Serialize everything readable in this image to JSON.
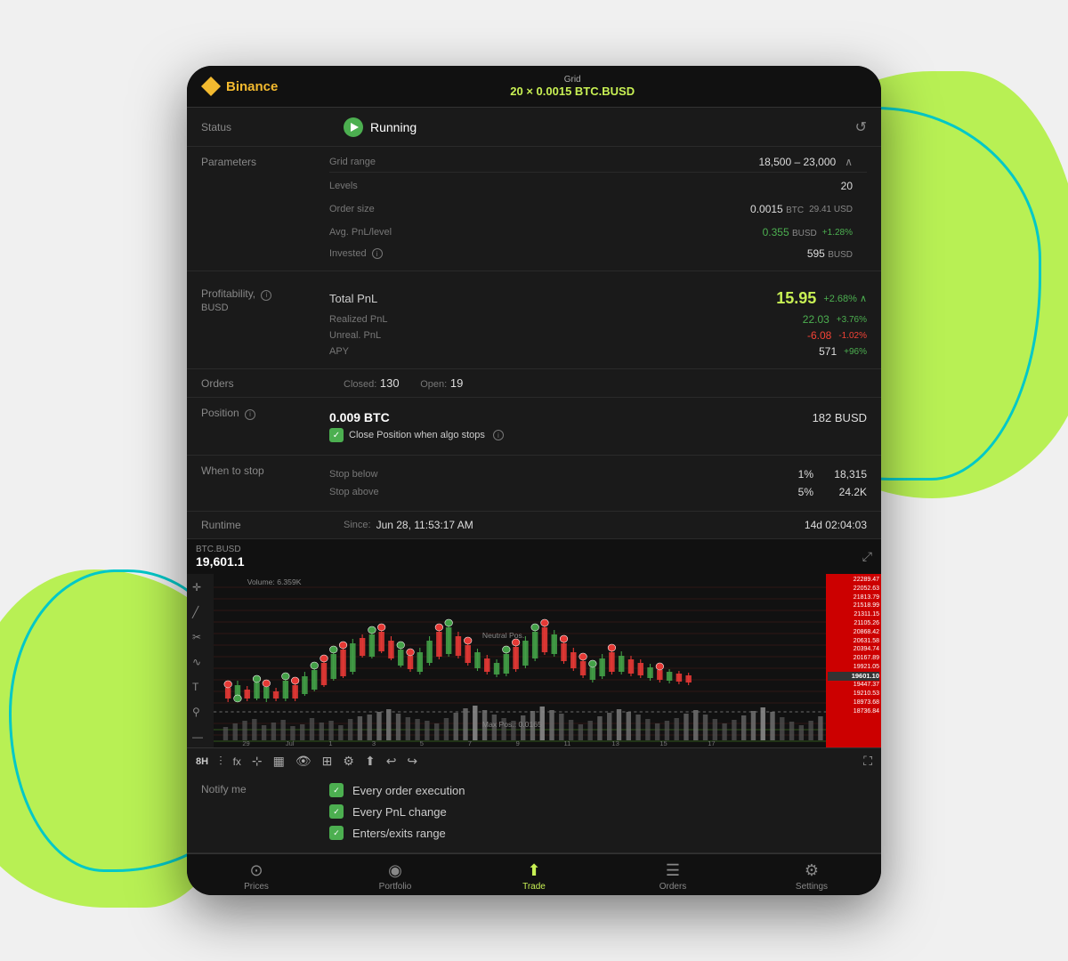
{
  "app": {
    "exchange": "Binance",
    "grid_label": "Grid",
    "grid_value": "20 × 0.0015 BTC.BUSD"
  },
  "status": {
    "label": "Status",
    "value": "Running",
    "refresh_icon": "↺"
  },
  "parameters": {
    "label": "Parameters",
    "grid_range_label": "Grid range",
    "grid_range_value": "18,500 – 23,000",
    "levels_label": "Levels",
    "levels_value": "20",
    "order_size_label": "Order size",
    "order_size_value": "0.0015",
    "order_size_unit": "BTC",
    "order_size_usd": "29.41 USD",
    "avg_pnl_label": "Avg. PnL/level",
    "avg_pnl_value": "0.355",
    "avg_pnl_unit": "BUSD",
    "avg_pnl_pct": "+1.28%",
    "invested_label": "Invested",
    "invested_value": "595",
    "invested_unit": "BUSD"
  },
  "profitability": {
    "label": "Profitability,",
    "unit": "BUSD",
    "total_pnl_label": "Total PnL",
    "total_pnl_value": "15.95",
    "total_pnl_pct": "+2.68%",
    "realized_label": "Realized PnL",
    "realized_value": "22.03",
    "realized_pct": "+3.76%",
    "unrealized_label": "Unreal. PnL",
    "unrealized_value": "-6.08",
    "unrealized_pct": "-1.02%",
    "apy_label": "APY",
    "apy_value": "571",
    "apy_pct": "+96%"
  },
  "orders": {
    "label": "Orders",
    "closed_label": "Closed:",
    "closed_value": "130",
    "open_label": "Open:",
    "open_value": "19"
  },
  "position": {
    "label": "Position",
    "btc_value": "0.009 BTC",
    "busd_value": "182 BUSD",
    "close_position_text": "Close Position when algo stops"
  },
  "when_to_stop": {
    "label": "When to stop",
    "stop_below_label": "Stop below",
    "stop_below_pct": "1%",
    "stop_below_value": "18,315",
    "stop_above_label": "Stop above",
    "stop_above_pct": "5%",
    "stop_above_value": "24.2K"
  },
  "runtime": {
    "label": "Runtime",
    "since_label": "Since:",
    "since_value": "Jun 28, 11:53:17 AM",
    "elapsed": "14d 02:04:03"
  },
  "chart": {
    "symbol": "BTC.BUSD",
    "price": "19,601.1",
    "time_frame": "8H",
    "price_levels": [
      "22289.47",
      "22052.63",
      "21813.79",
      "21518.99",
      "21311.15",
      "21105.26",
      "20868.42",
      "20631.58",
      "20394.74",
      "20167.89",
      "19921.05",
      "19601.10",
      "19447.37",
      "19210.53",
      "18973.68",
      "18736.84"
    ],
    "x_labels": [
      "29",
      "Jul",
      "1",
      "3",
      "5",
      "7",
      "9",
      "11",
      "13",
      "15",
      "17"
    ],
    "volume_label": "Volume: 6.359K",
    "neutral_pos_label": "Neutral Pos.",
    "max_pos_label": "Max Pos.: 0.0165"
  },
  "toolbar": {
    "time_frame": "8H",
    "icons": [
      "indicators",
      "fx",
      "crosshair",
      "layout",
      "eye",
      "layers",
      "settings",
      "share",
      "undo",
      "redo"
    ]
  },
  "notify_me": {
    "label": "Notify me",
    "items": [
      {
        "text": "Every order execution",
        "checked": true
      },
      {
        "text": "Every PnL change",
        "checked": true
      },
      {
        "text": "Enters/exits range",
        "checked": true
      }
    ]
  },
  "bottom_nav": {
    "items": [
      {
        "label": "Prices",
        "icon": "⊙",
        "active": false
      },
      {
        "label": "Portfolio",
        "icon": "◉",
        "active": false
      },
      {
        "label": "Trade",
        "icon": "⬆",
        "active": true
      },
      {
        "label": "Orders",
        "icon": "☰",
        "active": false
      },
      {
        "label": "Settings",
        "icon": "⚙",
        "active": false
      }
    ]
  }
}
